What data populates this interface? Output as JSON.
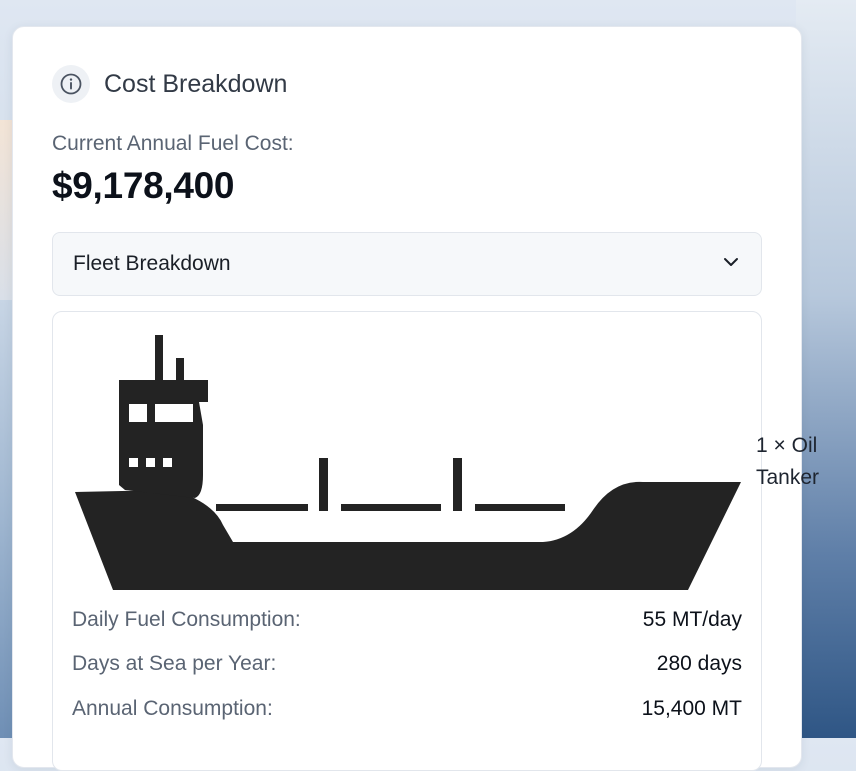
{
  "card": {
    "title": "Cost Breakdown",
    "info_icon": "info-icon",
    "cost_label": "Current Annual Fuel Cost:",
    "cost_value": "$9,178,400"
  },
  "dropdown": {
    "label": "Fleet Breakdown",
    "icon": "chevron-down-icon"
  },
  "vessel": {
    "icon": "oil-tanker-ship-icon",
    "count_label": "1 × Oil Tanker",
    "stats": [
      {
        "label": "Daily Fuel Consumption:",
        "value": "55 MT/day"
      },
      {
        "label": "Days at Sea per Year:",
        "value": "280 days"
      },
      {
        "label": "Annual Consumption:",
        "value": "15,400 MT"
      }
    ]
  }
}
